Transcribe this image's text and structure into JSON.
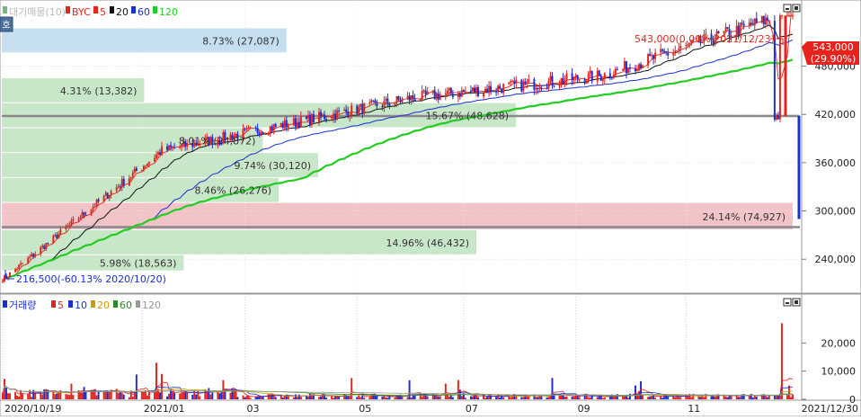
{
  "colors": {
    "up": "#e8231d",
    "down": "#1a2fd6",
    "ma5": "#e8231d",
    "ma20": "#111111",
    "ma60": "#1a2fd6",
    "ma120": "#22cc22",
    "vol20": "#c8a000",
    "vol60": "#2a8a2a",
    "vol120": "#999999",
    "profile_green": "#c8e6c8",
    "profile_blue": "#c6dff0",
    "profile_red": "#f2c4c8",
    "grid": "#e0e0e0",
    "hline": "#888888"
  },
  "price_legend": {
    "title": "대기매물(10)",
    "name": "BYC",
    "items": [
      {
        "label": "5",
        "color": "#e8231d"
      },
      {
        "label": "20",
        "color": "#111111"
      },
      {
        "label": "60",
        "color": "#1a2fd6"
      },
      {
        "label": "120",
        "color": "#22cc22"
      }
    ]
  },
  "volume_legend": {
    "title": "거래량",
    "items": [
      {
        "label": "5",
        "color": "#e8231d"
      },
      {
        "label": "10",
        "color": "#1a2fd6"
      },
      {
        "label": "20",
        "color": "#c8a000"
      },
      {
        "label": "60",
        "color": "#2a8a2a"
      },
      {
        "label": "120",
        "color": "#999999"
      }
    ]
  },
  "side_button": "호",
  "annotations": {
    "high": "543,000(0.00% 2021/12/23)",
    "low": "216,500(-60.13% 2020/10/20)",
    "last_price": "543,000",
    "last_change": "(29.90%)"
  },
  "chart_data": [
    {
      "type": "candlestick",
      "title": "BYC",
      "xlabel": "",
      "ylabel": "",
      "ylim": [
        200000,
        560000
      ],
      "yticks": [
        240000,
        300000,
        360000,
        420000,
        480000
      ],
      "ytick_labels": [
        "240,000",
        "300,000",
        "360,000",
        "420,000",
        "480,000"
      ],
      "x_labels": [
        {
          "date": "2020-10-19",
          "label": "2020/10/19"
        },
        {
          "date": "2021-01-04",
          "label": "2021/01"
        },
        {
          "date": "2021-03-02",
          "label": "03"
        },
        {
          "date": "2021-05-03",
          "label": "05"
        },
        {
          "date": "2021-07-01",
          "label": "07"
        },
        {
          "date": "2021-09-01",
          "label": "09"
        },
        {
          "date": "2021-11-01",
          "label": "11"
        },
        {
          "date": "2021-12-30",
          "label": "2021/12/30"
        }
      ],
      "x_range": [
        "2020-10-19",
        "2021-12-30"
      ],
      "key_prices": [
        {
          "date": "2020-10-20",
          "value": 216500,
          "label": "low"
        },
        {
          "date": "2021-01-15",
          "value": 375000
        },
        {
          "date": "2021-06-01",
          "value": 440000
        },
        {
          "date": "2021-09-15",
          "value": 468000
        },
        {
          "date": "2021-12-23",
          "value": 543000,
          "label": "high"
        }
      ],
      "horizontal_lines": [
        418000,
        280000
      ],
      "volume_profile": [
        {
          "low": 225000,
          "high": 245000,
          "pct": "5.98%",
          "volume": "(18,563)",
          "color": "green",
          "frac": 0.23
        },
        {
          "low": 245000,
          "high": 276000,
          "pct": "14.96%",
          "volume": "(46,432)",
          "color": "green",
          "frac": 0.6
        },
        {
          "low": 276000,
          "high": 310000,
          "pct": "24.14%",
          "volume": "(74,927)",
          "color": "red",
          "frac": 1.0
        },
        {
          "low": 310000,
          "high": 341000,
          "pct": "8.46%",
          "volume": "(26,276)",
          "color": "green",
          "frac": 0.35
        },
        {
          "low": 341000,
          "high": 372000,
          "pct": "9.74%",
          "volume": "(30,120)",
          "color": "green",
          "frac": 0.4
        },
        {
          "low": 372000,
          "high": 403000,
          "pct": "8.01%",
          "volume": "(24,872)",
          "color": "green",
          "frac": 0.33
        },
        {
          "low": 403000,
          "high": 434000,
          "pct": "15.67%",
          "volume": "(48,628)",
          "color": "green",
          "frac": 0.65
        },
        {
          "low": 434000,
          "high": 465000,
          "pct": "4.31%",
          "volume": "(13,382)",
          "color": "green",
          "frac": 0.18
        },
        {
          "low": 496000,
          "high": 527000,
          "pct": "8.73%",
          "volume": "(27,087)",
          "color": "blue",
          "frac": 0.36
        }
      ]
    },
    {
      "type": "bar",
      "title": "거래량",
      "xlabel": "",
      "ylabel": "",
      "ylim": [
        0,
        30000
      ],
      "yticks": [
        0,
        10000,
        20000
      ],
      "ytick_labels": [
        "0",
        "10,000",
        "20,000"
      ],
      "spikes": [
        {
          "date": "2021-01-12",
          "value": 13000
        },
        {
          "date": "2021-01-15",
          "value": 9000
        },
        {
          "date": "2021-12-24",
          "value": 27000
        }
      ]
    }
  ]
}
